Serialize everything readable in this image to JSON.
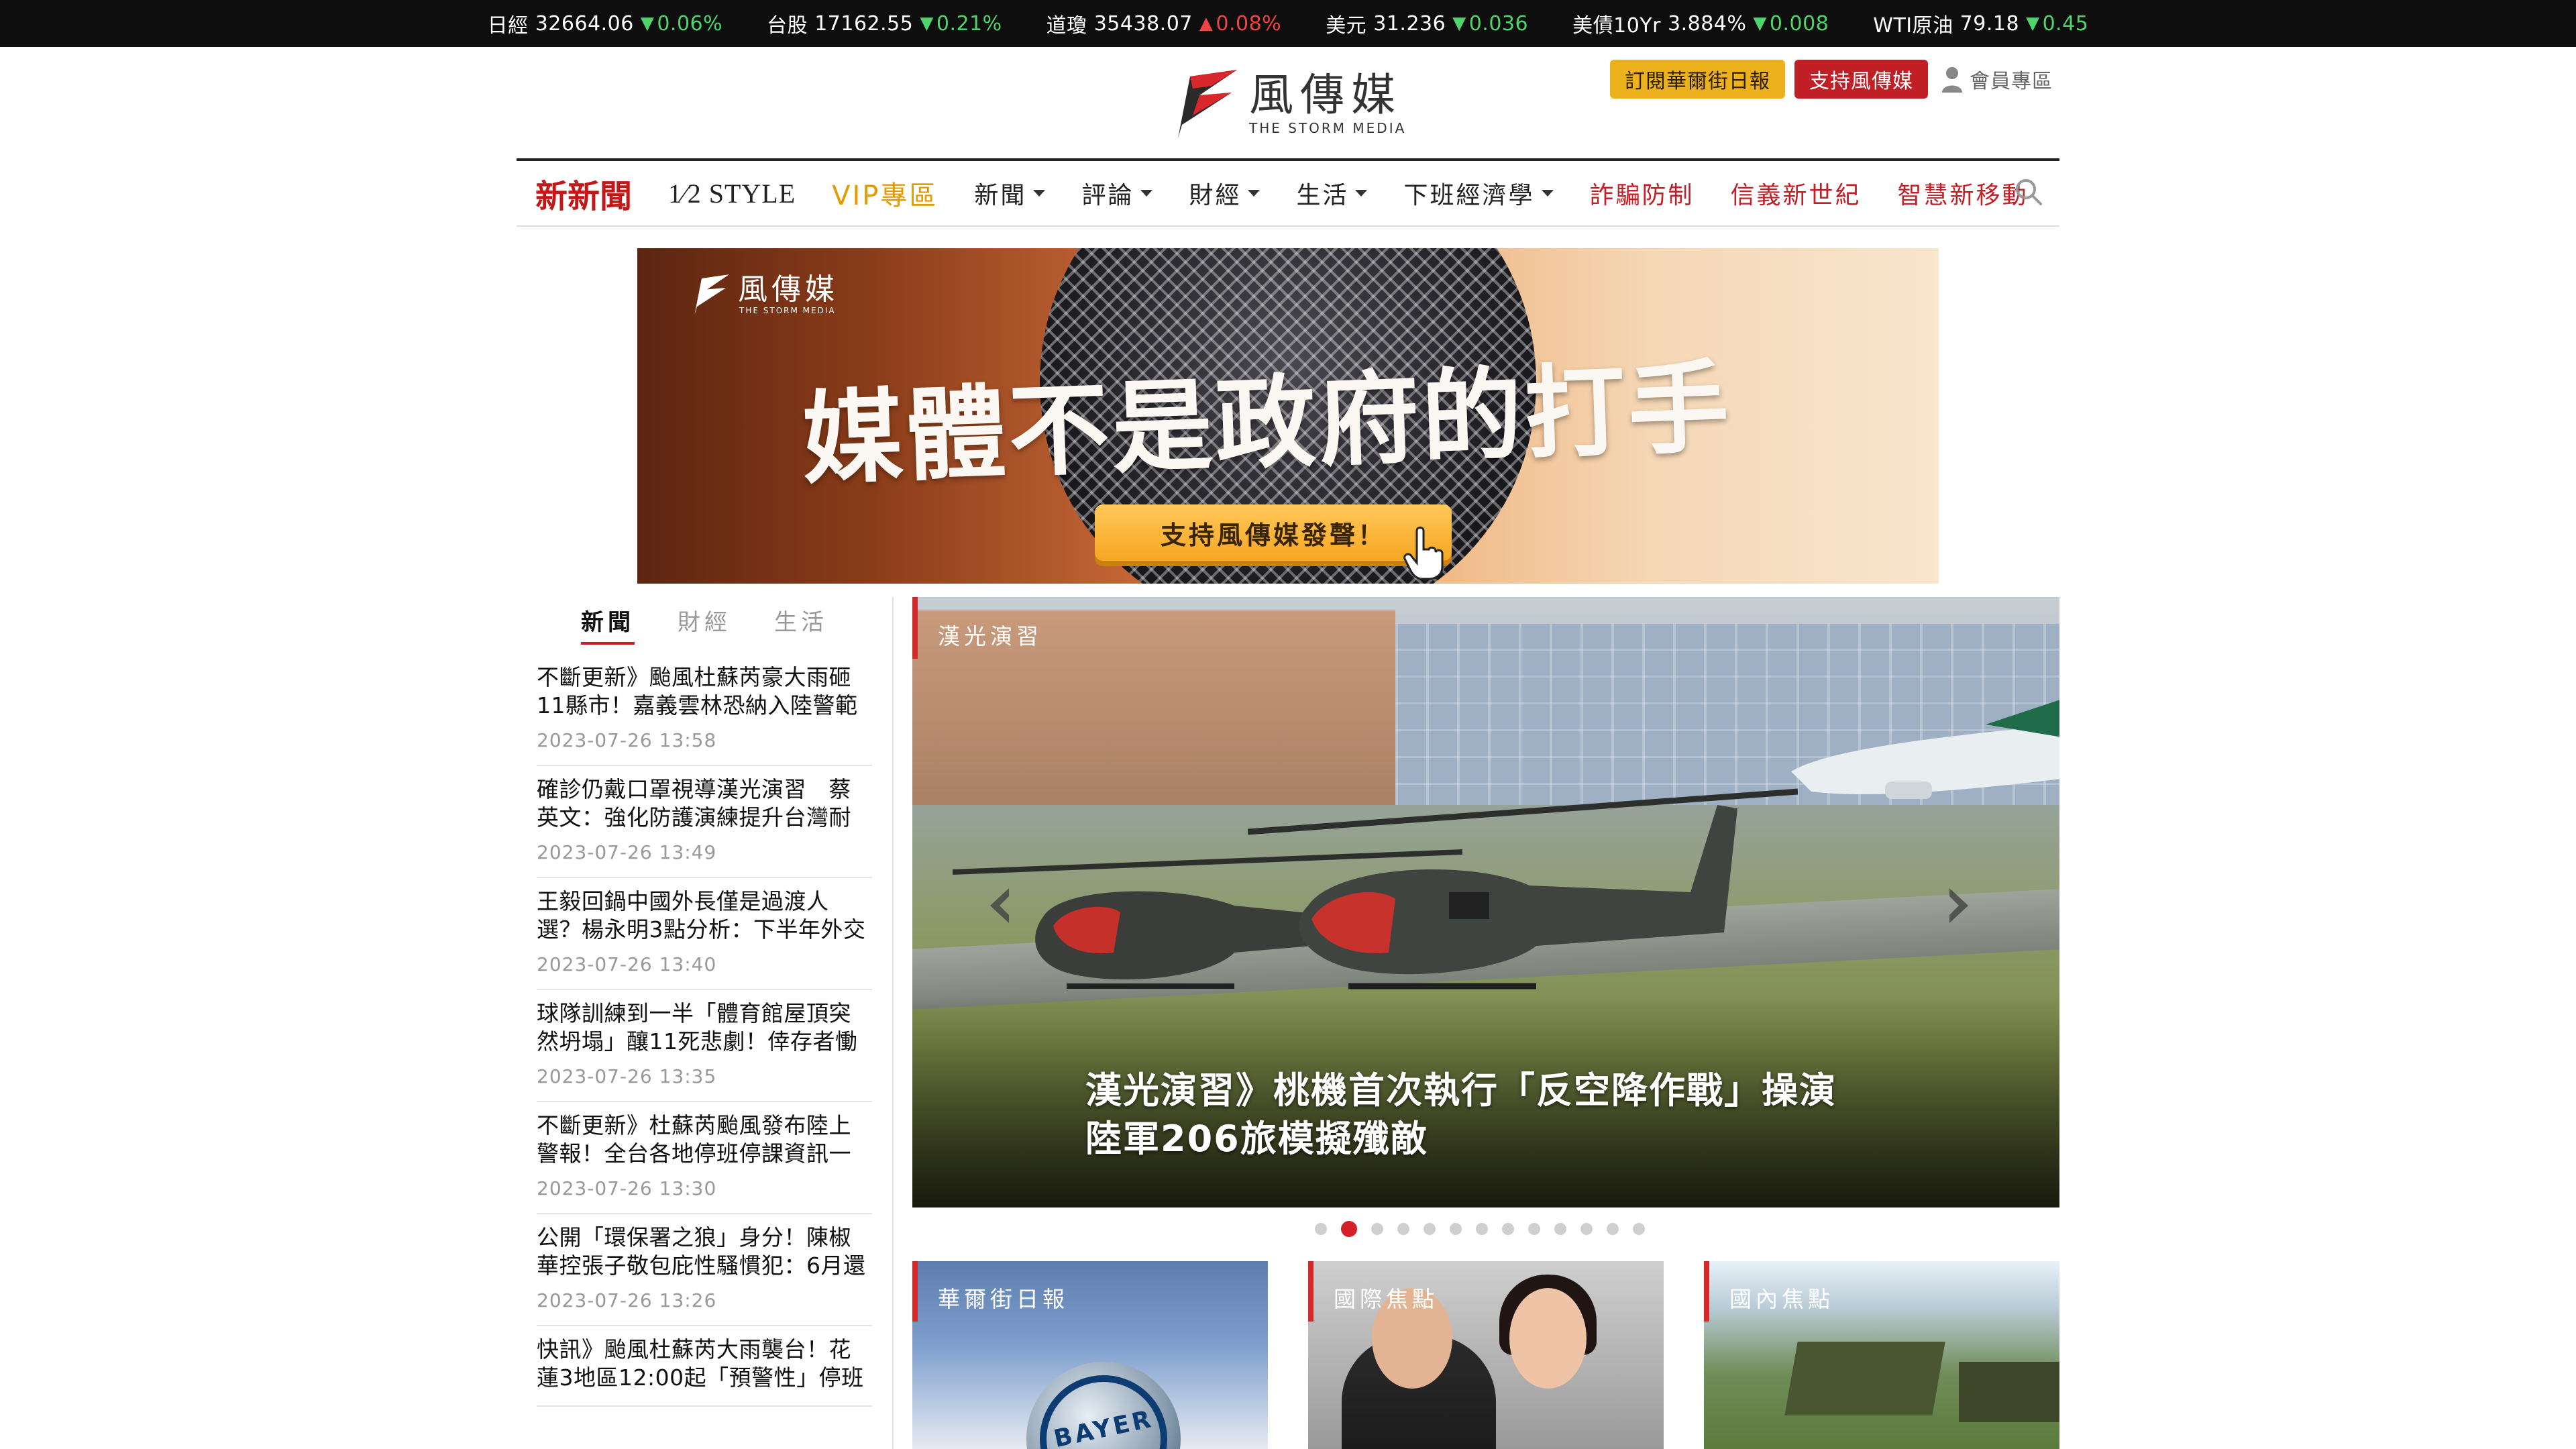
{
  "ticker": [
    {
      "name": "日經",
      "value": "32664.06",
      "direction": "down",
      "change": "0.06%"
    },
    {
      "name": "台股",
      "value": "17162.55",
      "direction": "down",
      "change": "0.21%"
    },
    {
      "name": "道瓊",
      "value": "35438.07",
      "direction": "up",
      "change": "0.08%"
    },
    {
      "name": "美元",
      "value": "31.236",
      "direction": "down",
      "change": "0.036"
    },
    {
      "name": "美債10Yr",
      "value": "3.884%",
      "direction": "down",
      "change": "0.008"
    },
    {
      "name": "WTI原油",
      "value": "79.18",
      "direction": "down",
      "change": "0.45"
    }
  ],
  "header": {
    "logo_zh": "風傳媒",
    "logo_en": "THE STORM MEDIA",
    "subscribe_label": "訂閱華爾街日報",
    "support_label": "支持風傳媒",
    "member_label": "會員專區"
  },
  "nav": {
    "new_news": "新新聞",
    "style": "1⁄2 STYLE",
    "vip": "VIP專區",
    "items": [
      "新聞",
      "評論",
      "財經",
      "生活",
      "下班經濟學"
    ],
    "red_items": [
      "詐騙防制",
      "信義新世紀",
      "智慧新移動"
    ]
  },
  "banner": {
    "logo_zh": "風傳媒",
    "logo_en": "THE STORM MEDIA",
    "slogan": "媒體不是政府的打手",
    "cta": "支持風傳媒發聲！"
  },
  "sidebar": {
    "tabs": [
      "新聞",
      "財經",
      "生活"
    ],
    "active_tab": "新聞",
    "news": [
      {
        "title": "不斷更新》颱風杜蘇芮豪大雨砸11縣市！嘉義雲林恐納入陸警範",
        "time": "2023-07-26 13:58"
      },
      {
        "title": "確診仍戴口罩視導漢光演習　蔡英文：強化防護演練提升台灣耐",
        "time": "2023-07-26 13:49"
      },
      {
        "title": "王毅回鍋中國外長僅是過渡人選？楊永明3點分析：下半年外交",
        "time": "2023-07-26 13:40"
      },
      {
        "title": "球隊訓練到一半「體育館屋頂突然坍塌」釀11死悲劇！倖存者慟",
        "time": "2023-07-26 13:35"
      },
      {
        "title": "不斷更新》杜蘇芮颱風發布陸上警報！全台各地停班停課資訊一",
        "time": "2023-07-26 13:30"
      },
      {
        "title": "公開「環保署之狼」身分！陳椒華控張子敬包庇性騷慣犯：6月還",
        "time": "2023-07-26 13:26"
      },
      {
        "title": "快訊》颱風杜蘇芮大雨襲台！花蓮3地區12:00起「預警性」停班",
        "time": ""
      }
    ]
  },
  "hero": {
    "category": "漢光演習",
    "title_line1": "漢光演習》桃機首次執行「反空降作戰」操演",
    "title_line2": "陸軍206旅模擬殲敵",
    "total_slides": 13,
    "active_slide": 2
  },
  "cards": [
    {
      "category": "華爾街日報"
    },
    {
      "category": "國際焦點"
    },
    {
      "category": "國內焦點"
    }
  ],
  "colors": {
    "accent_red": "#c41f27",
    "vip_gold": "#e49b00",
    "subscribe_yellow": "#eeb11e",
    "ticker_down": "#4ed46a",
    "ticker_up": "#f04343"
  }
}
